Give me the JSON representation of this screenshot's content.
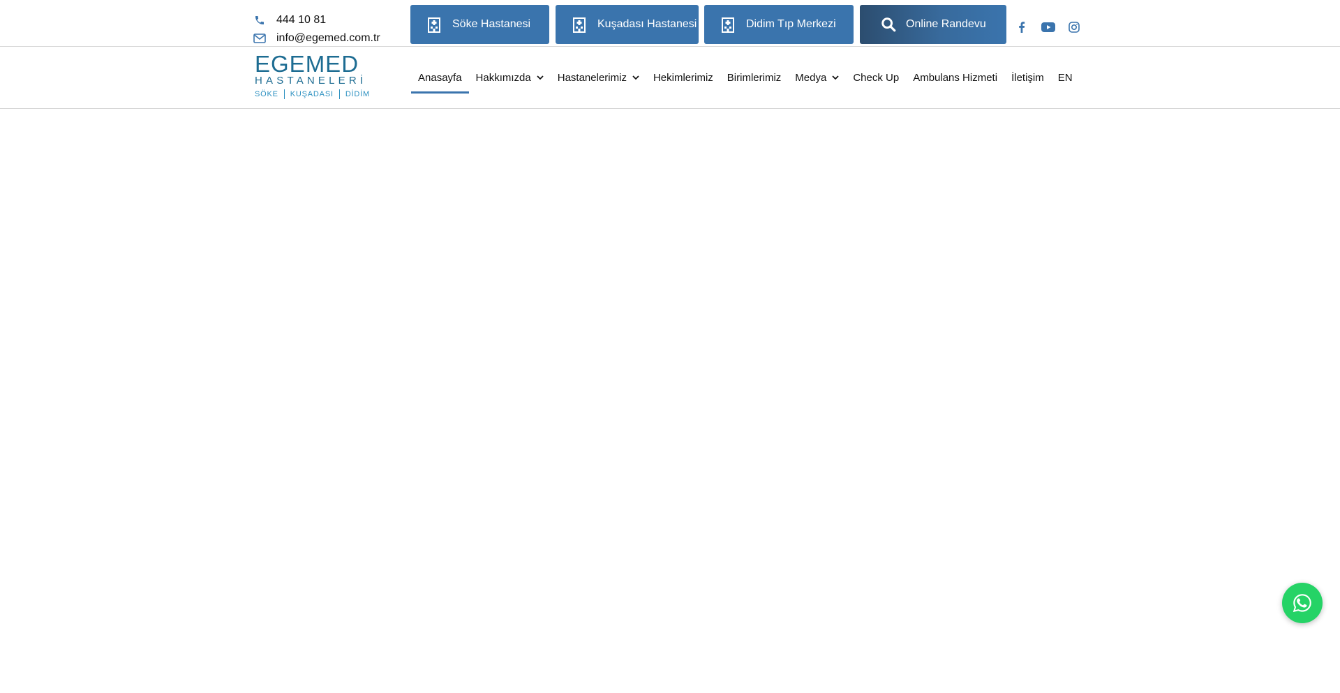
{
  "contact": {
    "phone": "444 10 81",
    "email": "info@egemed.com.tr",
    "phone_icon": "phone-icon",
    "email_icon": "envelope-icon"
  },
  "top_buttons": [
    {
      "label": "Söke Hastanesi",
      "icon": "hospital-icon"
    },
    {
      "label": "Kuşadası Hastanesi",
      "icon": "hospital-icon"
    },
    {
      "label": "Didim Tıp Merkezi",
      "icon": "hospital-icon"
    },
    {
      "label": "Online Randevu",
      "icon": "search-icon"
    }
  ],
  "social": [
    "facebook-icon",
    "youtube-icon",
    "instagram-icon"
  ],
  "logo": {
    "line1": "EGEMED",
    "line2": "HASTANELERİ",
    "line3": [
      "SÖKE",
      "KUŞADASI",
      "DİDİM"
    ]
  },
  "nav": {
    "items": [
      {
        "label": "Anasayfa",
        "active": true,
        "dropdown": false
      },
      {
        "label": "Hakkımızda",
        "active": false,
        "dropdown": true
      },
      {
        "label": "Hastanelerimiz",
        "active": false,
        "dropdown": true
      },
      {
        "label": "Hekimlerimiz",
        "active": false,
        "dropdown": false
      },
      {
        "label": "Birimlerimiz",
        "active": false,
        "dropdown": false
      },
      {
        "label": "Medya",
        "active": false,
        "dropdown": true
      },
      {
        "label": "Check Up",
        "active": false,
        "dropdown": false
      },
      {
        "label": "Ambulans Hizmeti",
        "active": false,
        "dropdown": false
      },
      {
        "label": "İletişim",
        "active": false,
        "dropdown": false
      },
      {
        "label": "EN",
        "active": false,
        "dropdown": false
      }
    ]
  },
  "colors": {
    "brand_blue": "#3a74ad",
    "logo_blue": "#1d6c92",
    "whatsapp_green": "#25d366"
  },
  "whatsapp": {
    "icon": "whatsapp-icon"
  }
}
